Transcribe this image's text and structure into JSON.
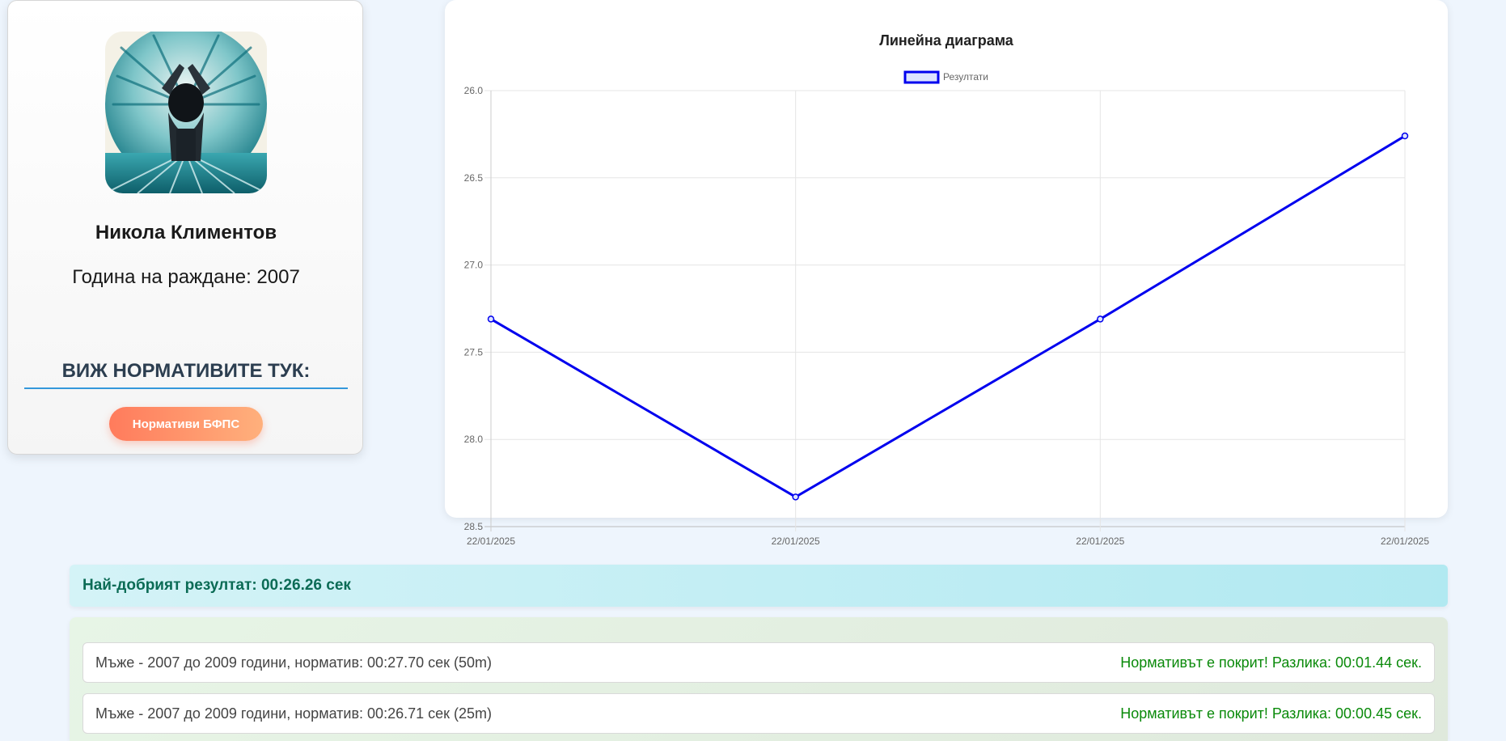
{
  "profile": {
    "name": "Никола Климентов",
    "birth_year_label": "Година на раждане: 2007",
    "norms_heading": "ВИЖ НОРМАТИВИТЕ ТУК:",
    "norms_button_label": "Нормативи БФПС"
  },
  "chart_data": {
    "type": "line",
    "title": "Линейна диаграма",
    "legend_position": "top-center",
    "grid": true,
    "y_reversed": true,
    "ylim": [
      26.0,
      28.5
    ],
    "y_ticks": [
      "26.0",
      "26.5",
      "27.0",
      "27.5",
      "28.0",
      "28.5"
    ],
    "categories": [
      "22/01/2025",
      "22/01/2025",
      "22/01/2025",
      "22/01/2025"
    ],
    "series": [
      {
        "name": "Резултати",
        "color": "#0000ee",
        "values": [
          27.31,
          28.33,
          27.31,
          26.26
        ]
      }
    ]
  },
  "best_result": {
    "text": "Най-добрият резултат: 00:26.26 сек"
  },
  "norms": [
    {
      "description": "Мъже - 2007 до 2009 години, норматив: 00:27.70 сек (50m)",
      "status": "Нормативът е покрит! Разлика: 00:01.44 сек."
    },
    {
      "description": "Мъже - 2007 до 2009 години, норматив: 00:26.71 сек (25m)",
      "status": "Нормативът е покрит! Разлика: 00:00.45 сек."
    }
  ],
  "colors": {
    "accent": "#3498db",
    "button_start": "#ff7b5c",
    "button_end": "#ffb07c",
    "success": "#0a8a0a",
    "best_result_text": "#0b6b55"
  },
  "icons": {
    "avatar": "swimmer-illustration"
  }
}
